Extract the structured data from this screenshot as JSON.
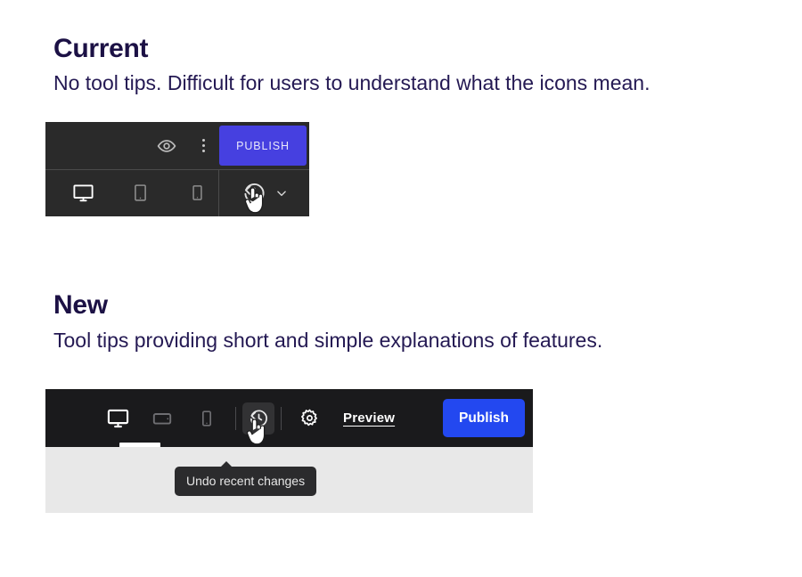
{
  "sections": [
    {
      "title": "Current",
      "subtitle": "No tool tips. Difficult for users to understand what the icons mean."
    },
    {
      "title": "New",
      "subtitle": "Tool tips providing short and simple explanations of features."
    }
  ],
  "old_toolbar": {
    "publish_label": "PUBLISH",
    "publish_color": "#4640e0",
    "background": "#2a2a2a",
    "divider_color": "#4b4b4b",
    "icons": {
      "preview_eye": "eye-icon",
      "more_options": "kebab-menu-icon",
      "desktop": "desktop-icon",
      "tablet": "tablet-icon",
      "mobile": "mobile-icon",
      "undo": "undo-history-icon",
      "chevron": "chevron-down-icon"
    }
  },
  "new_toolbar": {
    "publish_label": "Publish",
    "preview_label": "Preview",
    "publish_color": "#2348f0",
    "background": "#1a1a1c",
    "panel_color": "#e8e8e8",
    "active_device": "desktop",
    "tooltip": "Undo recent changes",
    "tooltip_background": "#2b2b2d",
    "icons": {
      "desktop": "desktop-icon",
      "tablet": "tablet-icon",
      "mobile": "mobile-icon",
      "undo": "undo-history-icon",
      "settings": "gear-icon"
    }
  },
  "cursor": "pointer-hand-cursor"
}
